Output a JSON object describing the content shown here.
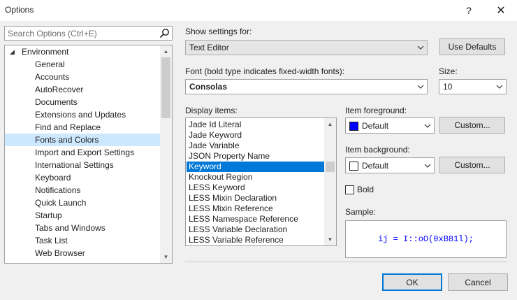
{
  "window": {
    "title": "Options",
    "help_glyph": "?",
    "close_glyph": "✕"
  },
  "search": {
    "placeholder": "Search Options (Ctrl+E)"
  },
  "tree": {
    "items": [
      {
        "label": "Environment",
        "expanded": true,
        "level": 0
      },
      {
        "label": "General",
        "level": 1
      },
      {
        "label": "Accounts",
        "level": 1
      },
      {
        "label": "AutoRecover",
        "level": 1
      },
      {
        "label": "Documents",
        "level": 1
      },
      {
        "label": "Extensions and Updates",
        "level": 1
      },
      {
        "label": "Find and Replace",
        "level": 1
      },
      {
        "label": "Fonts and Colors",
        "level": 1,
        "selected": true
      },
      {
        "label": "Import and Export Settings",
        "level": 1
      },
      {
        "label": "International Settings",
        "level": 1
      },
      {
        "label": "Keyboard",
        "level": 1
      },
      {
        "label": "Notifications",
        "level": 1
      },
      {
        "label": "Quick Launch",
        "level": 1
      },
      {
        "label": "Startup",
        "level": 1
      },
      {
        "label": "Tabs and Windows",
        "level": 1
      },
      {
        "label": "Task List",
        "level": 1
      },
      {
        "label": "Web Browser",
        "level": 1
      }
    ]
  },
  "settings": {
    "show_settings_label": "Show settings for:",
    "show_settings_value": "Text Editor",
    "use_defaults_label": "Use Defaults",
    "font_label": "Font (bold type indicates fixed-width fonts):",
    "font_value": "Consolas",
    "size_label": "Size:",
    "size_value": "10"
  },
  "display_items": {
    "label": "Display items:",
    "items": [
      "Jade Id Literal",
      "Jade Keyword",
      "Jade Variable",
      "JSON Property Name",
      "Keyword",
      "Knockout Region",
      "LESS Keyword",
      "LESS Mixin Declaration",
      "LESS Mixin Reference",
      "LESS Namespace Reference",
      "LESS Variable Declaration",
      "LESS Variable Reference"
    ],
    "selected_index": 4
  },
  "foreground": {
    "label": "Item foreground:",
    "value": "Default",
    "color": "#0000ff",
    "custom_label": "Custom..."
  },
  "background": {
    "label": "Item background:",
    "value": "Default",
    "color": "#ffffff",
    "custom_label": "Custom..."
  },
  "bold": {
    "label": "Bold",
    "checked": false
  },
  "sample": {
    "label": "Sample:",
    "text": "ij = I::oO(0xB81l);",
    "color": "#0000ff"
  },
  "footer": {
    "ok_label": "OK",
    "cancel_label": "Cancel"
  },
  "colors": {
    "accent": "#0078d7",
    "tree_selection": "#cce8ff"
  }
}
